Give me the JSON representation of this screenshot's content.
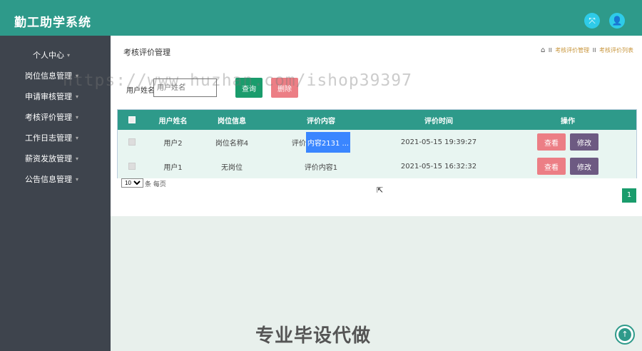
{
  "app": {
    "title": "勤工助学系统"
  },
  "topbar": {
    "fullscreen_icon": "fullscreen-icon",
    "user_icon": "user-icon"
  },
  "sidebar": {
    "items": [
      {
        "label": "个人中心"
      },
      {
        "label": "岗位信息管理"
      },
      {
        "label": "申请审核管理"
      },
      {
        "label": "考核评价管理"
      },
      {
        "label": "工作日志管理"
      },
      {
        "label": "薪资发放管理"
      },
      {
        "label": "公告信息管理"
      }
    ]
  },
  "page": {
    "title": "考核评价管理"
  },
  "breadcrumb": {
    "sep": "II",
    "item1": "考核评价管理",
    "item2": "考核评价列表"
  },
  "search": {
    "label": "用户姓名",
    "placeholder": "用户姓名",
    "query_label": "查询",
    "delete_label": "删除"
  },
  "table": {
    "headers": {
      "name": "用户姓名",
      "position": "岗位信息",
      "content": "评价内容",
      "time": "评价时间",
      "ops": "操作"
    },
    "rows": [
      {
        "name": "用户2",
        "position": "岗位名称4",
        "content_pre": "评价",
        "content_hl": "内容2131 ...",
        "time": "2021-05-15 19:39:27",
        "view": "查看",
        "edit": "修改"
      },
      {
        "name": "用户1",
        "position": "无岗位",
        "content_pre": "评价内容1",
        "content_hl": "",
        "time": "2021-05-15 16:32:32",
        "view": "查看",
        "edit": "修改"
      }
    ]
  },
  "pagination": {
    "page_size": "10",
    "page_size_label": "条 每页",
    "current_page": "1"
  },
  "overlay": {
    "watermark": "https://www.huzhan.com/ishop39397",
    "bottom_text": "专业毕设代做"
  },
  "colors": {
    "primary": "#2e9a8a",
    "sidebar": "#3e444d",
    "query": "#1a9c6c",
    "danger": "#ec7e85",
    "edit": "#6d5a82"
  }
}
